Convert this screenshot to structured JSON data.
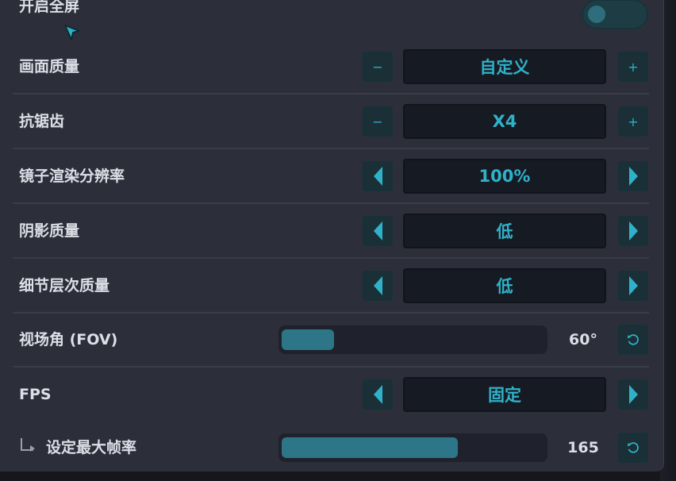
{
  "settings": {
    "fullscreen": {
      "label": "开启全屏",
      "enabled": false
    },
    "image_quality": {
      "label": "画面质量",
      "value": "自定义",
      "dec_symbol": "−",
      "inc_symbol": "+"
    },
    "anti_aliasing": {
      "label": "抗锯齿",
      "value": "X4",
      "dec_symbol": "−",
      "inc_symbol": "+"
    },
    "mirror_resolution": {
      "label": "镜子渲染分辨率",
      "value": "100%"
    },
    "shadow_quality": {
      "label": "阴影质量",
      "value": "低"
    },
    "lod_quality": {
      "label": "细节层次质量",
      "value": "低"
    },
    "fov": {
      "label": "视场角 (FOV)",
      "value": "60°",
      "fill_fraction": 0.2
    },
    "fps": {
      "label": "FPS",
      "value": "固定"
    },
    "max_framerate": {
      "label": "设定最大帧率",
      "value": "165",
      "fill_fraction": 0.67
    }
  },
  "icons": {
    "arrow_left": "triangle-left-icon",
    "arrow_right": "triangle-right-icon",
    "reset": "reset-icon",
    "cursor": "mouse-cursor-icon"
  },
  "colors": {
    "accent": "#2fb2c9",
    "panel": "#2c2f3a",
    "value_bg": "#161a23"
  }
}
